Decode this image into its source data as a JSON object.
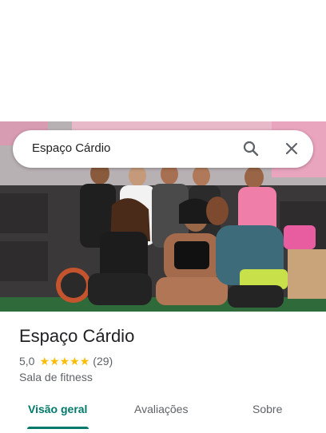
{
  "search": {
    "query": "Espaço Cárdio"
  },
  "place": {
    "name": "Espaço Cárdio",
    "rating": "5,0",
    "stars": 5,
    "review_count": "(29)",
    "category": "Sala de fitness"
  },
  "tabs": [
    {
      "label": "Visão geral",
      "active": true
    },
    {
      "label": "Avaliações",
      "active": false
    },
    {
      "label": "Sobre",
      "active": false
    }
  ],
  "colors": {
    "accent": "#00796b",
    "star": "#fbbc04",
    "secondary_text": "#5f6368"
  },
  "icons": {
    "search": "search-icon",
    "close": "close-icon",
    "star": "star-icon"
  }
}
